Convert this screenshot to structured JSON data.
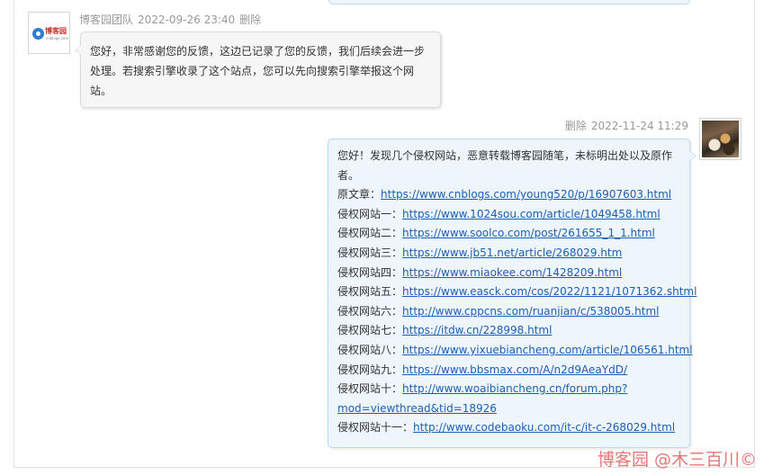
{
  "message1": {
    "author": "博客园团队",
    "datetime": "2022-09-26 23:40",
    "delete_label": "删除",
    "avatar_logo": "博客园",
    "avatar_logo_sub": "cnblogs.com",
    "content": "您好，非常感谢您的反馈，这边已记录了您的反馈，我们后续会进一步处理。若搜索引擎收录了这个站点，您可以先向搜索引擎举报这个网站。"
  },
  "message2": {
    "delete_label": "删除",
    "datetime": "2022-11-24 11:29",
    "intro": "您好！发现几个侵权网站，恶意转载博客园随笔，未标明出处以及原作者。",
    "original": {
      "label": "原文章：",
      "url": "https://www.cnblogs.com/young520/p/16907603.html"
    },
    "sites": [
      {
        "label": "侵权网站一：",
        "url": "https://www.1024sou.com/article/1049458.html"
      },
      {
        "label": "侵权网站二：",
        "url": "https://www.soolco.com/post/261655_1_1.html"
      },
      {
        "label": "侵权网站三：",
        "url": "https://www.jb51.net/article/268029.htm"
      },
      {
        "label": "侵权网站四：",
        "url": "https://www.miaokee.com/1428209.html"
      },
      {
        "label": "侵权网站五：",
        "url": "https://www.easck.com/cos/2022/1121/1071362.shtml"
      },
      {
        "label": "侵权网站六：",
        "url": "http://www.cppcns.com/ruanjian/c/538005.html"
      },
      {
        "label": "侵权网站七：",
        "url": "https://itdw.cn/228998.html"
      },
      {
        "label": "侵权网站八：",
        "url": "https://www.yixuebiancheng.com/article/106561.html"
      },
      {
        "label": "侵权网站九：",
        "url": "https://www.bbsmax.com/A/n2d9AeaYdD/"
      },
      {
        "label": "侵权网站十：",
        "url_line1": "http://www.woaibiancheng.cn/forum.php?",
        "url_line2": "mod=viewthread&tid=18926"
      },
      {
        "label": "侵权网站十一：",
        "url": "http://www.codebaoku.com/it-c/it-c-268029.html"
      }
    ]
  },
  "watermark": "博客园 @木三百川©",
  "colors": {
    "link": "#1a5fb4",
    "meta": "#999999",
    "left_bubble": "#f6f6f6",
    "right_bubble": "#eef6fc",
    "watermark": "#e36a6a"
  }
}
